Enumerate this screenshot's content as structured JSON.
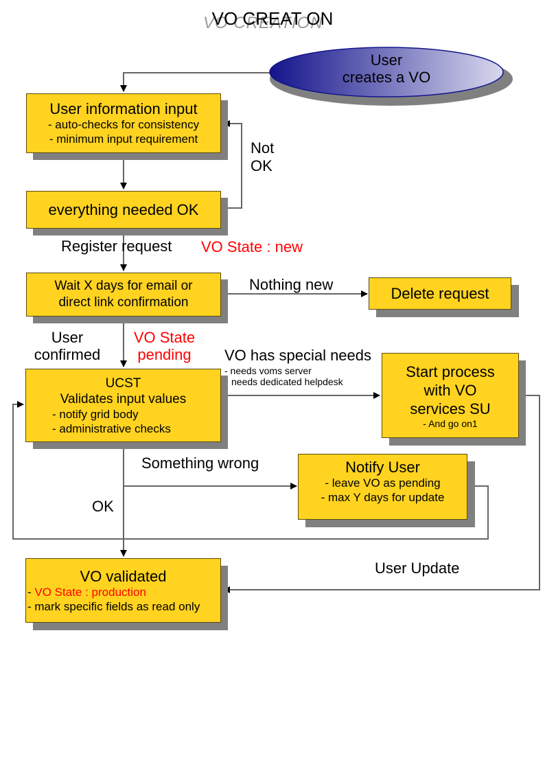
{
  "title": "VO CREATION",
  "title_display": "VO CREAT ON",
  "title_ghost": "VO CREATION",
  "colors": {
    "box_fill": "#ffd320",
    "shadow": "#808080",
    "state_text": "#ff0000",
    "ellipse_dark": "#14148c",
    "ellipse_light": "#d0d0ea",
    "connector": "#666666"
  },
  "start": {
    "line1": "User",
    "line2": "creates a VO"
  },
  "nodes": {
    "user_input": {
      "title": "User information input",
      "items": [
        "- auto-checks for consistency",
        "- minimum input requirement"
      ]
    },
    "everything_ok": {
      "title": "everything needed OK"
    },
    "wait": {
      "line1": "Wait X days for email or",
      "line2": "direct link confirmation"
    },
    "delete": {
      "title": "Delete request"
    },
    "ucst": {
      "title": "UCST",
      "subtitle": "Validates input values",
      "items": [
        "- notify grid body",
        "- administrative checks"
      ]
    },
    "start_process": {
      "line1": "Start process",
      "line2": "with VO",
      "line3": "services SU",
      "note": "- And go on1"
    },
    "notify": {
      "title": "Notify User",
      "items": [
        "- leave VO as pending",
        "- max Y days for update"
      ]
    },
    "validated": {
      "title": "VO validated",
      "state_prefix": "- ",
      "state": "VO State : production",
      "items": [
        "- mark specific fields as read only"
      ]
    }
  },
  "edges": {
    "not_ok": {
      "line1": "Not",
      "line2": "OK"
    },
    "register": "Register request",
    "state_new": "VO State :  new",
    "nothing_new": "Nothing new",
    "user_confirmed": {
      "line1": "User",
      "line2": "confirmed"
    },
    "state_pending": {
      "line1": "VO State",
      "line2": "pending"
    },
    "special_needs": {
      "title": "VO has special needs",
      "line1": "- needs voms server",
      "line2": "  needs dedicated helpdesk"
    },
    "something_wrong": "Something wrong",
    "ok": "OK",
    "user_update": "User Update"
  }
}
